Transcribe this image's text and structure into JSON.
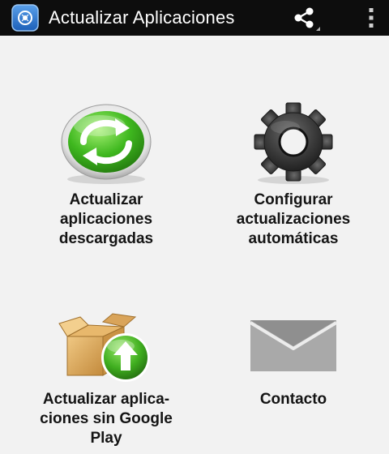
{
  "action_bar": {
    "title": "Actualizar Aplicaciones",
    "app_icon": "app-logo-icon",
    "share_icon": "share-icon",
    "overflow_icon": "overflow-menu-icon"
  },
  "tiles": [
    {
      "label": "Actualizar\naplicaciones\ndescargadas",
      "icon": "refresh-icon"
    },
    {
      "label": "Configurar\nactualizaciones\nautomáticas",
      "icon": "gear-icon"
    },
    {
      "label": "Actualizar aplica-\nciones sin Google\nPlay",
      "icon": "box-upload-icon"
    },
    {
      "label": "Contacto",
      "icon": "mail-icon"
    }
  ],
  "colors": {
    "action_bar": "#0d0d0d",
    "background": "#f2f2f2",
    "accent_green": "#3fb81f",
    "text": "#141414"
  }
}
